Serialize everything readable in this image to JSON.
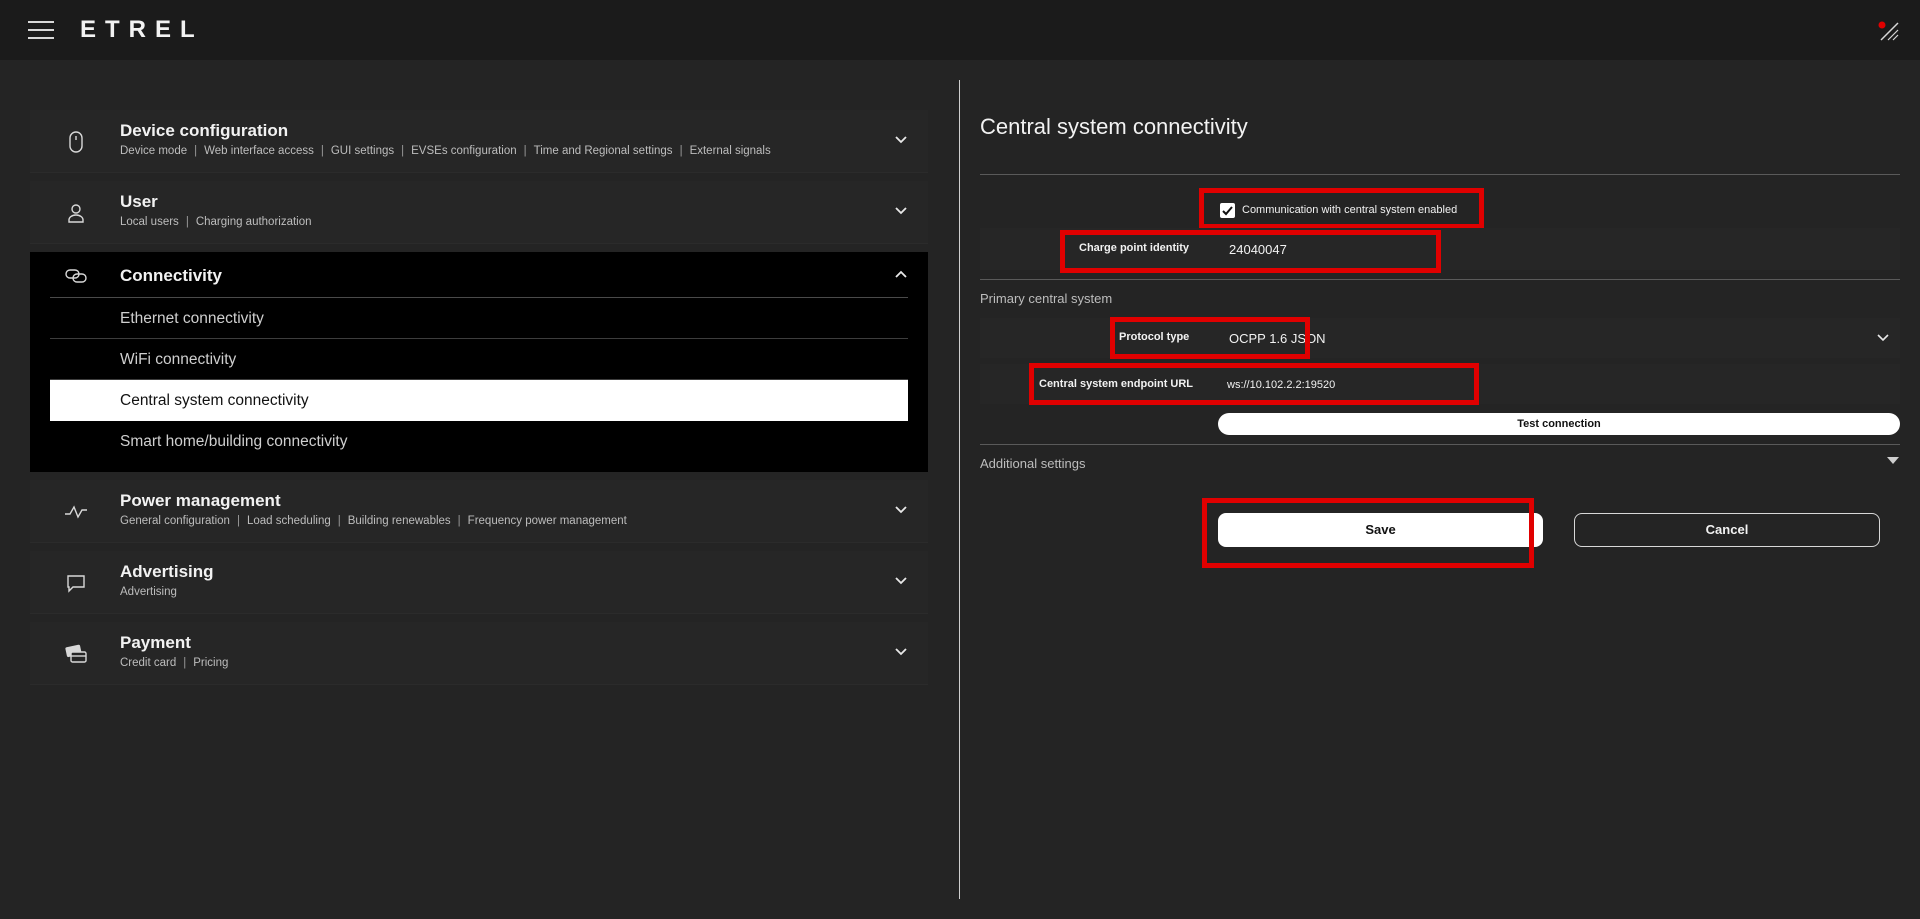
{
  "header": {
    "logo": "ETREL"
  },
  "sidebar": {
    "device_config": {
      "title": "Device configuration",
      "items": [
        "Device mode",
        "Web interface access",
        "GUI settings",
        "EVSEs configuration",
        "Time and Regional settings",
        "External signals"
      ]
    },
    "user": {
      "title": "User",
      "items": [
        "Local users",
        "Charging authorization"
      ]
    },
    "connectivity": {
      "title": "Connectivity",
      "items": [
        "Ethernet connectivity",
        "WiFi connectivity",
        "Central system connectivity",
        "Smart home/building connectivity"
      ]
    },
    "power": {
      "title": "Power management",
      "items": [
        "General configuration",
        "Load scheduling",
        "Building renewables",
        "Frequency power management"
      ]
    },
    "advertising": {
      "title": "Advertising",
      "items": [
        "Advertising"
      ]
    },
    "payment": {
      "title": "Payment",
      "items": [
        "Credit card",
        "Pricing"
      ]
    }
  },
  "main": {
    "title": "Central system connectivity",
    "comm_enabled_label": "Communication with central system enabled",
    "comm_enabled": true,
    "charge_point_label": "Charge point identity",
    "charge_point_value": "24040047",
    "primary_section": "Primary central system",
    "protocol_label": "Protocol type",
    "protocol_value": "OCPP 1.6 JSON",
    "endpoint_label": "Central system endpoint URL",
    "endpoint_value": "ws://10.102.2.2:19520",
    "test_button": "Test connection",
    "additional_settings": "Additional settings",
    "save_button": "Save",
    "cancel_button": "Cancel"
  },
  "colors": {
    "highlight": "#e00000",
    "background": "#242424",
    "topbar": "#1b1b1b"
  }
}
